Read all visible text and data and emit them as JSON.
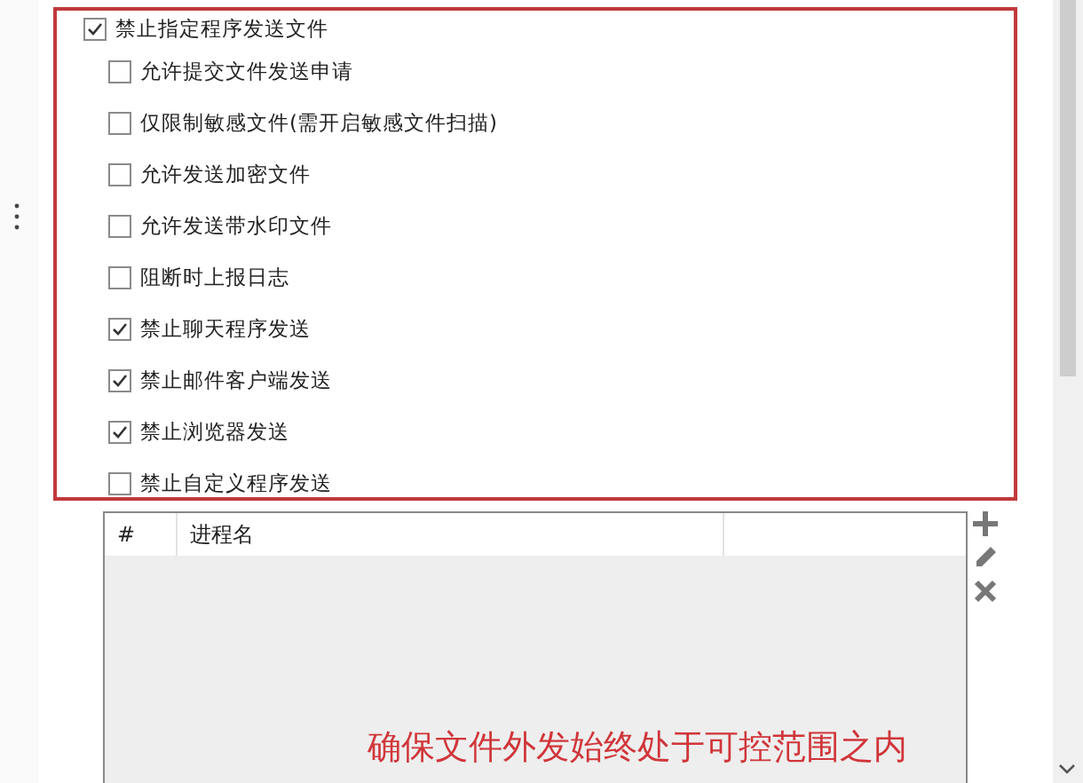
{
  "options": [
    {
      "label": "禁止指定程序发送文件",
      "checked": true,
      "children": [
        {
          "label": "允许提交文件发送申请",
          "checked": false
        },
        {
          "label": "仅限制敏感文件(需开启敏感文件扫描)",
          "checked": false
        },
        {
          "label": "允许发送加密文件",
          "checked": false
        },
        {
          "label": "允许发送带水印文件",
          "checked": false
        },
        {
          "label": "阻断时上报日志",
          "checked": false
        },
        {
          "label": "禁止聊天程序发送",
          "checked": true
        },
        {
          "label": "禁止邮件客户端发送",
          "checked": true
        },
        {
          "label": "禁止浏览器发送",
          "checked": true
        },
        {
          "label": "禁止自定义程序发送",
          "checked": false
        }
      ]
    }
  ],
  "table": {
    "columns": [
      "#",
      "进程名"
    ]
  },
  "caption": "确保文件外发始终处于可控范围之内"
}
